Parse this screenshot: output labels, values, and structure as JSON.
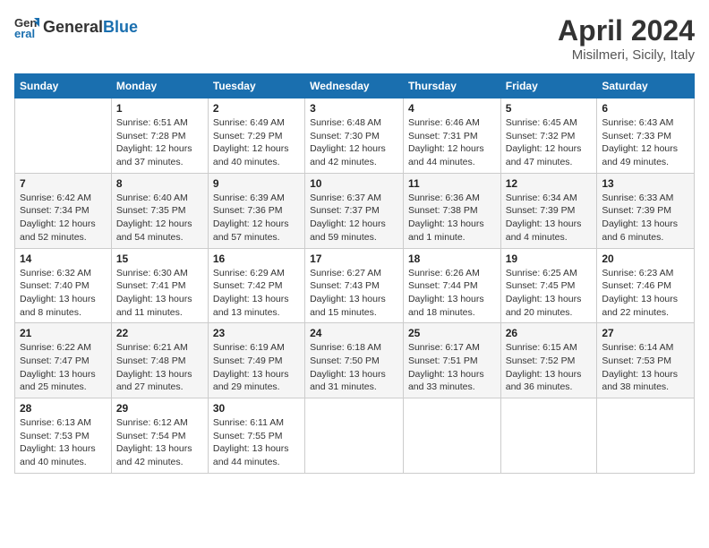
{
  "logo": {
    "general": "General",
    "blue": "Blue"
  },
  "title": "April 2024",
  "location": "Misilmeri, Sicily, Italy",
  "weekdays": [
    "Sunday",
    "Monday",
    "Tuesday",
    "Wednesday",
    "Thursday",
    "Friday",
    "Saturday"
  ],
  "weeks": [
    [
      {
        "day": "",
        "info": ""
      },
      {
        "day": "1",
        "info": "Sunrise: 6:51 AM\nSunset: 7:28 PM\nDaylight: 12 hours\nand 37 minutes."
      },
      {
        "day": "2",
        "info": "Sunrise: 6:49 AM\nSunset: 7:29 PM\nDaylight: 12 hours\nand 40 minutes."
      },
      {
        "day": "3",
        "info": "Sunrise: 6:48 AM\nSunset: 7:30 PM\nDaylight: 12 hours\nand 42 minutes."
      },
      {
        "day": "4",
        "info": "Sunrise: 6:46 AM\nSunset: 7:31 PM\nDaylight: 12 hours\nand 44 minutes."
      },
      {
        "day": "5",
        "info": "Sunrise: 6:45 AM\nSunset: 7:32 PM\nDaylight: 12 hours\nand 47 minutes."
      },
      {
        "day": "6",
        "info": "Sunrise: 6:43 AM\nSunset: 7:33 PM\nDaylight: 12 hours\nand 49 minutes."
      }
    ],
    [
      {
        "day": "7",
        "info": "Sunrise: 6:42 AM\nSunset: 7:34 PM\nDaylight: 12 hours\nand 52 minutes."
      },
      {
        "day": "8",
        "info": "Sunrise: 6:40 AM\nSunset: 7:35 PM\nDaylight: 12 hours\nand 54 minutes."
      },
      {
        "day": "9",
        "info": "Sunrise: 6:39 AM\nSunset: 7:36 PM\nDaylight: 12 hours\nand 57 minutes."
      },
      {
        "day": "10",
        "info": "Sunrise: 6:37 AM\nSunset: 7:37 PM\nDaylight: 12 hours\nand 59 minutes."
      },
      {
        "day": "11",
        "info": "Sunrise: 6:36 AM\nSunset: 7:38 PM\nDaylight: 13 hours\nand 1 minute."
      },
      {
        "day": "12",
        "info": "Sunrise: 6:34 AM\nSunset: 7:39 PM\nDaylight: 13 hours\nand 4 minutes."
      },
      {
        "day": "13",
        "info": "Sunrise: 6:33 AM\nSunset: 7:39 PM\nDaylight: 13 hours\nand 6 minutes."
      }
    ],
    [
      {
        "day": "14",
        "info": "Sunrise: 6:32 AM\nSunset: 7:40 PM\nDaylight: 13 hours\nand 8 minutes."
      },
      {
        "day": "15",
        "info": "Sunrise: 6:30 AM\nSunset: 7:41 PM\nDaylight: 13 hours\nand 11 minutes."
      },
      {
        "day": "16",
        "info": "Sunrise: 6:29 AM\nSunset: 7:42 PM\nDaylight: 13 hours\nand 13 minutes."
      },
      {
        "day": "17",
        "info": "Sunrise: 6:27 AM\nSunset: 7:43 PM\nDaylight: 13 hours\nand 15 minutes."
      },
      {
        "day": "18",
        "info": "Sunrise: 6:26 AM\nSunset: 7:44 PM\nDaylight: 13 hours\nand 18 minutes."
      },
      {
        "day": "19",
        "info": "Sunrise: 6:25 AM\nSunset: 7:45 PM\nDaylight: 13 hours\nand 20 minutes."
      },
      {
        "day": "20",
        "info": "Sunrise: 6:23 AM\nSunset: 7:46 PM\nDaylight: 13 hours\nand 22 minutes."
      }
    ],
    [
      {
        "day": "21",
        "info": "Sunrise: 6:22 AM\nSunset: 7:47 PM\nDaylight: 13 hours\nand 25 minutes."
      },
      {
        "day": "22",
        "info": "Sunrise: 6:21 AM\nSunset: 7:48 PM\nDaylight: 13 hours\nand 27 minutes."
      },
      {
        "day": "23",
        "info": "Sunrise: 6:19 AM\nSunset: 7:49 PM\nDaylight: 13 hours\nand 29 minutes."
      },
      {
        "day": "24",
        "info": "Sunrise: 6:18 AM\nSunset: 7:50 PM\nDaylight: 13 hours\nand 31 minutes."
      },
      {
        "day": "25",
        "info": "Sunrise: 6:17 AM\nSunset: 7:51 PM\nDaylight: 13 hours\nand 33 minutes."
      },
      {
        "day": "26",
        "info": "Sunrise: 6:15 AM\nSunset: 7:52 PM\nDaylight: 13 hours\nand 36 minutes."
      },
      {
        "day": "27",
        "info": "Sunrise: 6:14 AM\nSunset: 7:53 PM\nDaylight: 13 hours\nand 38 minutes."
      }
    ],
    [
      {
        "day": "28",
        "info": "Sunrise: 6:13 AM\nSunset: 7:53 PM\nDaylight: 13 hours\nand 40 minutes."
      },
      {
        "day": "29",
        "info": "Sunrise: 6:12 AM\nSunset: 7:54 PM\nDaylight: 13 hours\nand 42 minutes."
      },
      {
        "day": "30",
        "info": "Sunrise: 6:11 AM\nSunset: 7:55 PM\nDaylight: 13 hours\nand 44 minutes."
      },
      {
        "day": "",
        "info": ""
      },
      {
        "day": "",
        "info": ""
      },
      {
        "day": "",
        "info": ""
      },
      {
        "day": "",
        "info": ""
      }
    ]
  ]
}
